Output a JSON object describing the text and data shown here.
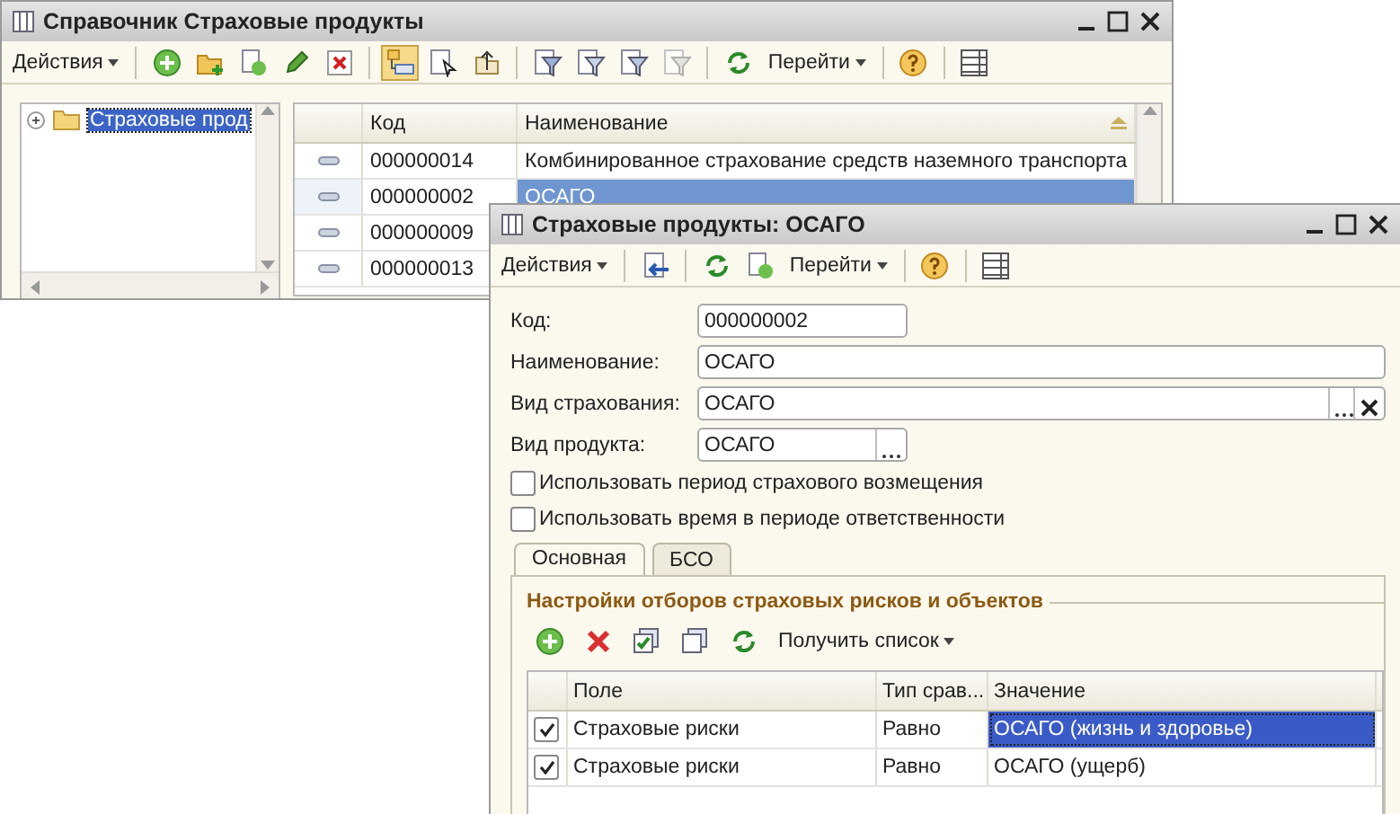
{
  "list_window": {
    "title": "Справочник Страховые продукты",
    "toolbar": {
      "actions": "Действия",
      "goto": "Перейти",
      "hierarchy_mode": {
        "selected": true
      },
      "clear_filter": {
        "disabled": true
      }
    },
    "tree": {
      "items": [
        {
          "label": "Страховые прод",
          "selected": true,
          "expanded": false
        }
      ]
    },
    "grid": {
      "columns": [
        "Код",
        "Наименование"
      ],
      "rows": [
        {
          "code": "000000014",
          "name": "Комбинированное страхование средств наземного транспорта",
          "selected": false
        },
        {
          "code": "000000002",
          "name": "ОСАГО",
          "selected": true
        },
        {
          "code": "000000009",
          "selected": false
        },
        {
          "code": "000000013",
          "selected": false
        }
      ]
    }
  },
  "item_window": {
    "title": "Страховые продукты: ОСАГО",
    "toolbar": {
      "actions": "Действия",
      "goto": "Перейти"
    },
    "fields": [
      {
        "label": "Код:",
        "value": "000000002",
        "kind": "code"
      },
      {
        "label": "Наименование:",
        "value": "ОСАГО",
        "kind": "text"
      },
      {
        "label": "Вид страхования:",
        "value": "ОСАГО",
        "kind": "reference"
      },
      {
        "label": "Вид продукта:",
        "value": "ОСАГО",
        "kind": "picker"
      }
    ],
    "checkboxes": [
      {
        "label": "Использовать период страхового возмещения",
        "checked": false
      },
      {
        "label": "Использовать время в периоде ответственности",
        "checked": false
      }
    ],
    "tabs": [
      {
        "label": "Основная",
        "selected": true
      },
      {
        "label": "БСО",
        "selected": false
      }
    ],
    "filter_group": {
      "title": "Настройки отборов страховых рисков и объектов",
      "get_list": "Получить список",
      "table": {
        "columns": [
          "Поле",
          "Тип срав...",
          "Значение"
        ],
        "rows": [
          {
            "checked": true,
            "field": "Страховые риски",
            "comparison": "Равно",
            "value": "ОСАГО (жизнь и здоровье)",
            "selected": true
          },
          {
            "checked": true,
            "field": "Страховые риски",
            "comparison": "Равно",
            "value": "ОСАГО (ущерб)",
            "selected": false
          }
        ]
      }
    }
  }
}
